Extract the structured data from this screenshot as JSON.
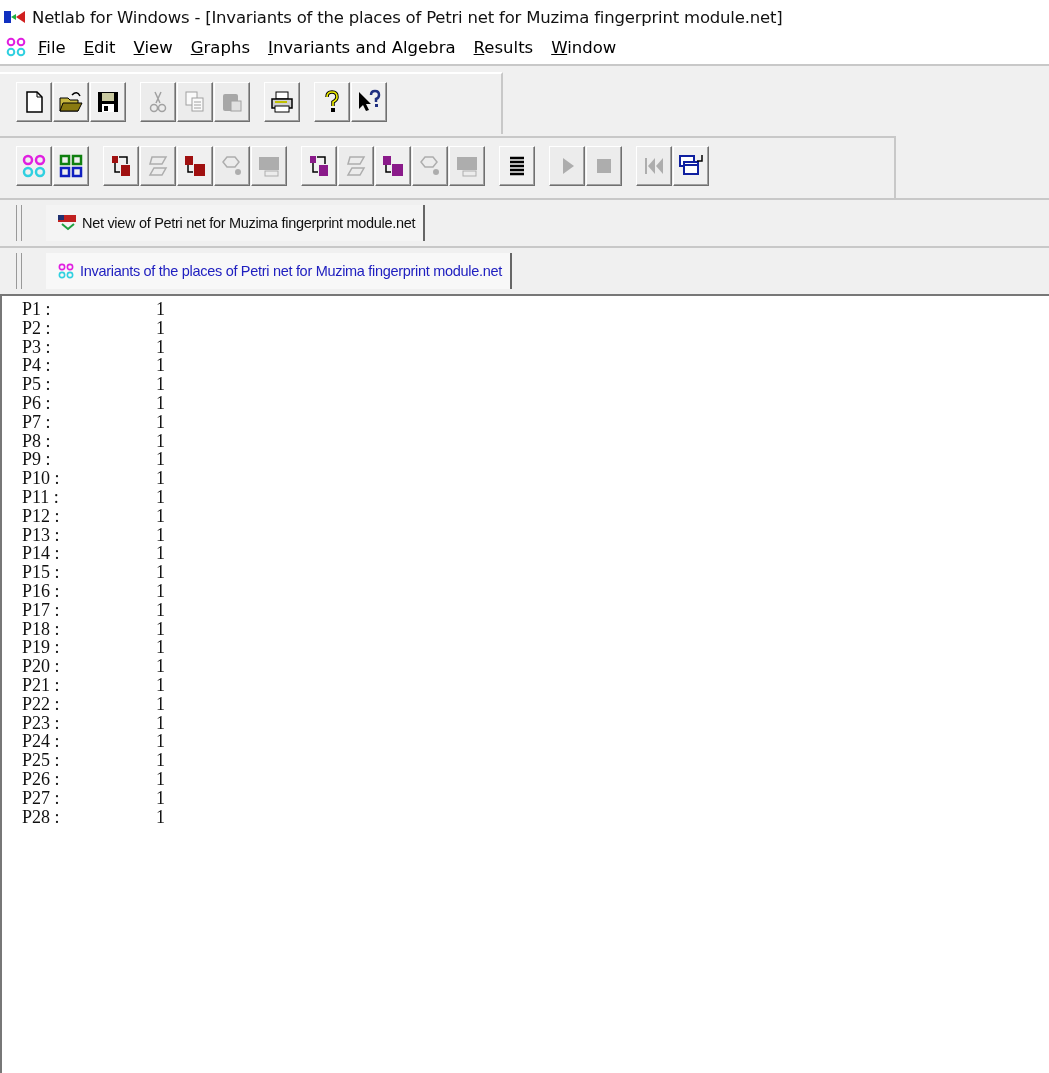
{
  "window": {
    "title": "Netlab for Windows - [Invariants of the places of Petri net for Muzima fingerprint module.net]"
  },
  "menu": [
    {
      "label": "File"
    },
    {
      "label": "Edit"
    },
    {
      "label": "View"
    },
    {
      "label": "Graphs"
    },
    {
      "label": "Invariants and Algebra"
    },
    {
      "label": "Results"
    },
    {
      "label": "Window"
    }
  ],
  "toolbars": [
    {
      "groups": [
        [
          {
            "kind": "new",
            "disabled": false
          },
          {
            "kind": "open",
            "disabled": false
          },
          {
            "kind": "save",
            "disabled": false
          }
        ],
        [
          {
            "kind": "cut",
            "disabled": true
          },
          {
            "kind": "copy",
            "disabled": true
          },
          {
            "kind": "paste",
            "disabled": true
          }
        ],
        [
          {
            "kind": "print",
            "disabled": false
          }
        ],
        [
          {
            "kind": "help",
            "disabled": false
          },
          {
            "kind": "context-help",
            "disabled": false
          }
        ]
      ]
    },
    {
      "groups": [
        [
          {
            "kind": "places",
            "disabled": false
          },
          {
            "kind": "grid",
            "disabled": false
          }
        ],
        [
          {
            "kind": "swap",
            "color": "#a01010",
            "disabled": false
          },
          {
            "kind": "flow",
            "disabled": true
          },
          {
            "kind": "ab",
            "color": "#a01010",
            "disabled": false
          },
          {
            "kind": "net",
            "disabled": true
          },
          {
            "kind": "screen",
            "disabled": true
          }
        ],
        [
          {
            "kind": "swap",
            "color": "#8a1a8a",
            "disabled": false
          },
          {
            "kind": "flow",
            "disabled": true
          },
          {
            "kind": "ab",
            "color": "#8a1a8a",
            "disabled": false
          },
          {
            "kind": "net",
            "disabled": true
          },
          {
            "kind": "screen",
            "disabled": true
          }
        ],
        [
          {
            "kind": "lines",
            "disabled": false
          }
        ],
        [
          {
            "kind": "play",
            "disabled": true
          },
          {
            "kind": "stop",
            "disabled": true
          }
        ],
        [
          {
            "kind": "first",
            "disabled": true
          },
          {
            "kind": "windows",
            "disabled": false
          }
        ]
      ]
    }
  ],
  "window_tabs": [
    {
      "label": "Net view of Petri net for Muzima fingerprint module.net",
      "kind": "net",
      "selected": false
    },
    {
      "label": "Invariants of the places of Petri net for Muzima fingerprint module.net",
      "kind": "places",
      "selected": true
    }
  ],
  "invariants": [
    {
      "place": "P1 :",
      "value": "1"
    },
    {
      "place": "P2 :",
      "value": "1"
    },
    {
      "place": "P3 :",
      "value": "1"
    },
    {
      "place": "P4 :",
      "value": "1"
    },
    {
      "place": "P5 :",
      "value": "1"
    },
    {
      "place": "P6 :",
      "value": "1"
    },
    {
      "place": "P7 :",
      "value": "1"
    },
    {
      "place": "P8 :",
      "value": "1"
    },
    {
      "place": "P9 :",
      "value": "1"
    },
    {
      "place": "P10 :",
      "value": "1"
    },
    {
      "place": "P11 :",
      "value": "1"
    },
    {
      "place": "P12 :",
      "value": "1"
    },
    {
      "place": "P13 :",
      "value": "1"
    },
    {
      "place": "P14 :",
      "value": "1"
    },
    {
      "place": "P15 :",
      "value": "1"
    },
    {
      "place": "P16 :",
      "value": "1"
    },
    {
      "place": "P17 :",
      "value": "1"
    },
    {
      "place": "P18 :",
      "value": "1"
    },
    {
      "place": "P19 :",
      "value": "1"
    },
    {
      "place": "P20 :",
      "value": "1"
    },
    {
      "place": "P21 :",
      "value": "1"
    },
    {
      "place": "P22 :",
      "value": "1"
    },
    {
      "place": "P23 :",
      "value": "1"
    },
    {
      "place": "P24 :",
      "value": "1"
    },
    {
      "place": "P25 :",
      "value": "1"
    },
    {
      "place": "P26 :",
      "value": "1"
    },
    {
      "place": "P27 :",
      "value": "1"
    },
    {
      "place": "P28 :",
      "value": "1"
    }
  ]
}
